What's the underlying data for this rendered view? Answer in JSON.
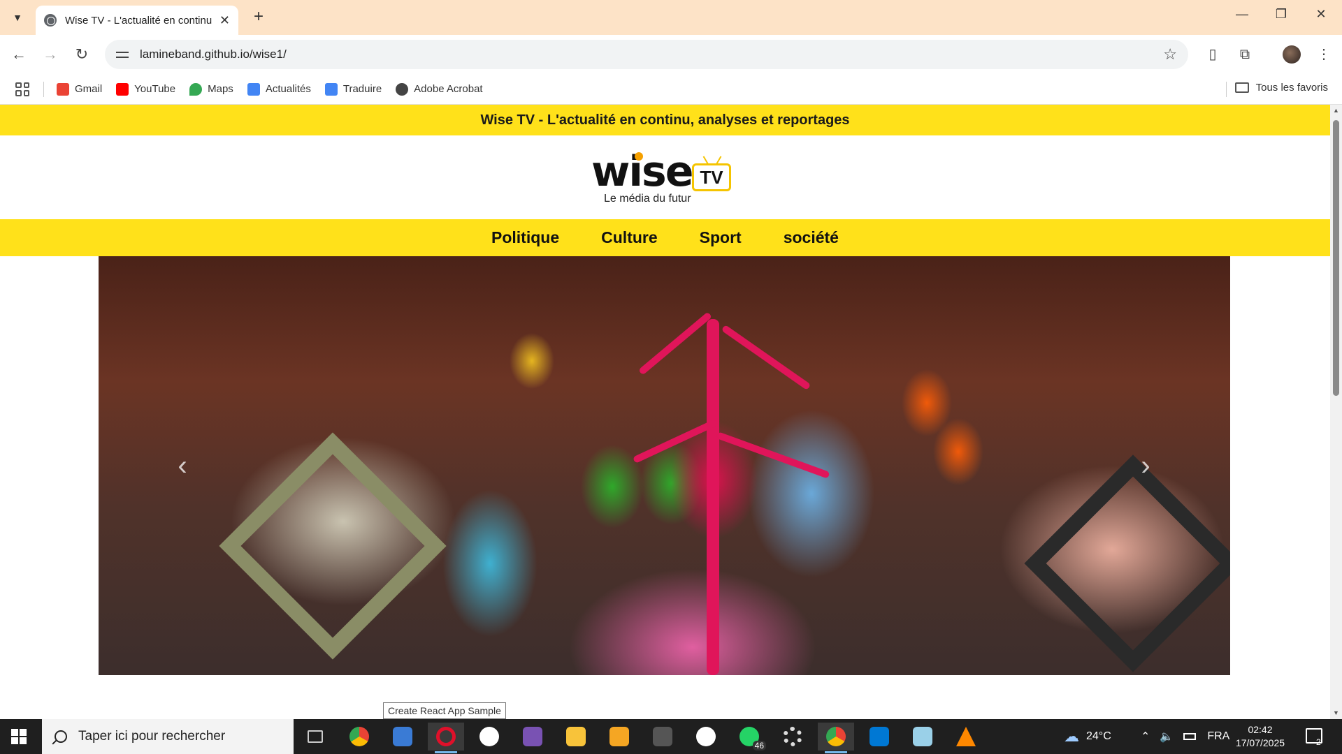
{
  "browser": {
    "tab_title": "Wise TV - L'actualité en continu",
    "url": "lamineband.github.io/wise1/",
    "bookmarks": [
      {
        "label": "Gmail",
        "icon": "gmail-icon",
        "color": "#ea4335"
      },
      {
        "label": "YouTube",
        "icon": "youtube-icon",
        "color": "#ff0000"
      },
      {
        "label": "Maps",
        "icon": "maps-icon",
        "color": "#34a853"
      },
      {
        "label": "Actualités",
        "icon": "news-icon",
        "color": "#4285f4"
      },
      {
        "label": "Traduire",
        "icon": "translate-icon",
        "color": "#4285f4"
      },
      {
        "label": "Adobe Acrobat",
        "icon": "globe-icon",
        "color": "#444444"
      }
    ],
    "all_favorites": "Tous les favoris"
  },
  "page": {
    "headline": "Wise TV - L'actualité en continu, analyses et reportages",
    "logo": {
      "wordmark": "wise",
      "tv": "TV",
      "tagline": "Le média du futur"
    },
    "nav": [
      "Politique",
      "Culture",
      "Sport",
      "société"
    ],
    "carousel": {
      "prev": "‹",
      "next": "›"
    },
    "tooltip": "Create React App Sample"
  },
  "taskbar": {
    "search_placeholder": "Taper ici pour rechercher",
    "apps": [
      {
        "name": "task-view",
        "color": "#cccccc"
      },
      {
        "name": "chrome",
        "color": "#4285f4"
      },
      {
        "name": "remote-desktop",
        "color": "#3a7bd5"
      },
      {
        "name": "opera",
        "color": "#e0102a"
      },
      {
        "name": "github",
        "color": "#ffffff"
      },
      {
        "name": "bootstrap-studio",
        "color": "#7952b3"
      },
      {
        "name": "file-explorer",
        "color": "#f8c33a"
      },
      {
        "name": "sublime",
        "color": "#f5a623"
      },
      {
        "name": "app-w",
        "color": "#888888"
      },
      {
        "name": "mongodb",
        "color": "#13aa52"
      },
      {
        "name": "whatsapp",
        "color": "#25d366"
      },
      {
        "name": "settings",
        "color": "#dddddd"
      },
      {
        "name": "chrome-active",
        "color": "#4285f4"
      },
      {
        "name": "vscode",
        "color": "#0078d4"
      },
      {
        "name": "app-blue",
        "color": "#9ad0e8"
      },
      {
        "name": "vlc",
        "color": "#ff8800"
      }
    ],
    "whatsapp_badge": "46",
    "weather": "24°C",
    "language": "FRA",
    "time": "02:42",
    "date": "17/07/2025",
    "notifications": "2"
  }
}
